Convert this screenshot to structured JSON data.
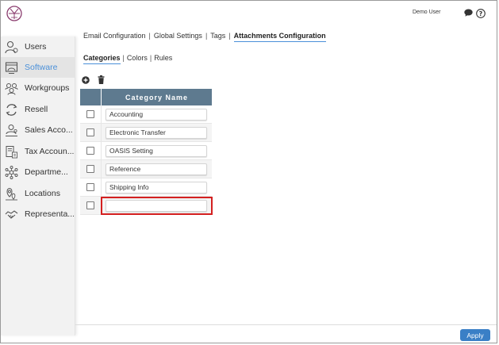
{
  "header": {
    "user_name": "Demo User",
    "icons": [
      "logo-icon",
      "chat-icon",
      "help-icon"
    ]
  },
  "sidebar": {
    "items": [
      {
        "label": "Users",
        "icon": "users-icon",
        "active": false
      },
      {
        "label": "Software",
        "icon": "software-icon",
        "active": true
      },
      {
        "label": "Workgroups",
        "icon": "workgroups-icon",
        "active": false
      },
      {
        "label": "Resell",
        "icon": "resell-icon",
        "active": false
      },
      {
        "label": "Sales Acco...",
        "icon": "sales-accounts-icon",
        "active": false
      },
      {
        "label": "Tax Accoun...",
        "icon": "tax-accounts-icon",
        "active": false
      },
      {
        "label": "Departme...",
        "icon": "departments-icon",
        "active": false
      },
      {
        "label": "Locations",
        "icon": "locations-icon",
        "active": false
      },
      {
        "label": "Representa...",
        "icon": "representatives-icon",
        "active": false
      }
    ]
  },
  "top_tabs": {
    "email": "Email Configuration",
    "global": "Global Settings",
    "tags": "Tags",
    "attachments": "Attachments Configuration",
    "separator": "|"
  },
  "sub_tabs": {
    "categories": "Categories",
    "colors": "Colors",
    "rules": "Rules",
    "separator": "|"
  },
  "table": {
    "header": "Category Name",
    "rows": [
      "Accounting",
      "Electronic Transfer",
      "OASIS Setting",
      "Reference",
      "Shipping Info",
      ""
    ]
  },
  "footer": {
    "apply_label": "Apply"
  },
  "colors": {
    "accent": "#4a90d9",
    "table_header": "#5e7a8f",
    "apply_button": "#3a7fc6",
    "highlight": "#d42020"
  }
}
